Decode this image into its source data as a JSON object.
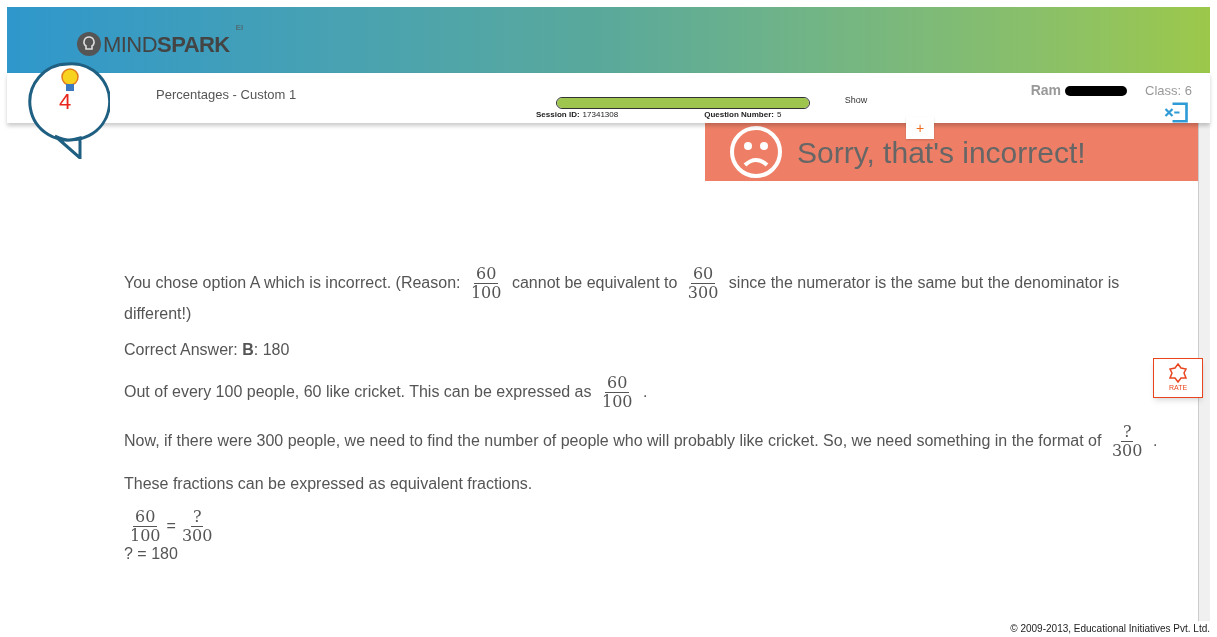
{
  "header": {
    "logo_light": "MIND",
    "logo_bold": "SPARK",
    "logo_sup": "EI"
  },
  "hints": {
    "count": "4"
  },
  "topic": "Percentages - Custom 1",
  "session": {
    "progress": {
      "level": 1
    },
    "session_label": "Session ID:",
    "session_id": "17341308",
    "question_label": "Question Number:",
    "question_number": "5"
  },
  "show": {
    "label": "Show",
    "button": "+"
  },
  "user": {
    "name": "Ram",
    "class": "Class: 6"
  },
  "feedback": {
    "message": "Sorry, that's incorrect!"
  },
  "rate": {
    "label": "RATE"
  },
  "explanation": [
    [
      {
        "kind": "text",
        "text": "You chose option A which is incorrect. (Reason: "
      },
      {
        "kind": "frac",
        "num": "60",
        "den": "100"
      },
      {
        "kind": "text",
        "text": " cannot be equivalent to "
      },
      {
        "kind": "frac",
        "num": "60",
        "den": "300"
      },
      {
        "kind": "text",
        "text": " since the numerator is the same but the denominator is different!)"
      }
    ],
    [
      {
        "kind": "text",
        "text": "Correct Answer: **B**: 180"
      }
    ],
    [
      {
        "kind": "text",
        "text": "Out of every 100 people, 60 like cricket. This can be expressed as "
      },
      {
        "kind": "frac",
        "num": "60",
        "den": "100"
      },
      {
        "kind": "text",
        "text": " ."
      }
    ],
    [
      {
        "kind": "text",
        "text": "Now, if there were 300 people, we need to find the number of people who will probably like cricket. So, we need something in the format of "
      },
      {
        "kind": "frac",
        "num": "?",
        "den": "300"
      },
      {
        "kind": "text",
        "text": " ."
      }
    ],
    [
      {
        "kind": "text",
        "text": "These fractions can be expressed as equivalent fractions."
      }
    ],
    [
      {
        "kind": "frac",
        "num": "60",
        "den": "100"
      },
      {
        "kind": "text",
        "text": "="
      },
      {
        "kind": "frac",
        "num": "?",
        "den": "300"
      }
    ],
    [
      {
        "kind": "text",
        "text": "? = 180"
      }
    ]
  ],
  "footer": "© 2009-2013, Educational Initiatives Pvt. Ltd."
}
